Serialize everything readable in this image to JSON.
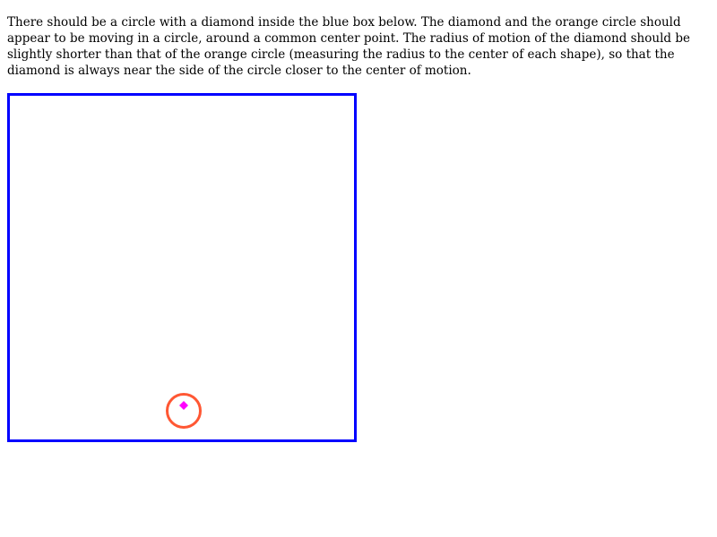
{
  "instructions": "There should be a circle with a diamond inside the blue box below. The diamond and the orange circle should appear to be moving in a circle, around a common center point. The radius of motion of the diamond should be slightly shorter than that of the orange circle (measuring the radius to the center of each shape), so that the diamond is always near the side of the circle closer to the center of motion.",
  "colors": {
    "box_border": "#0000ff",
    "circle_stroke": "#ff5733",
    "diamond_fill": "#ff00ff"
  }
}
